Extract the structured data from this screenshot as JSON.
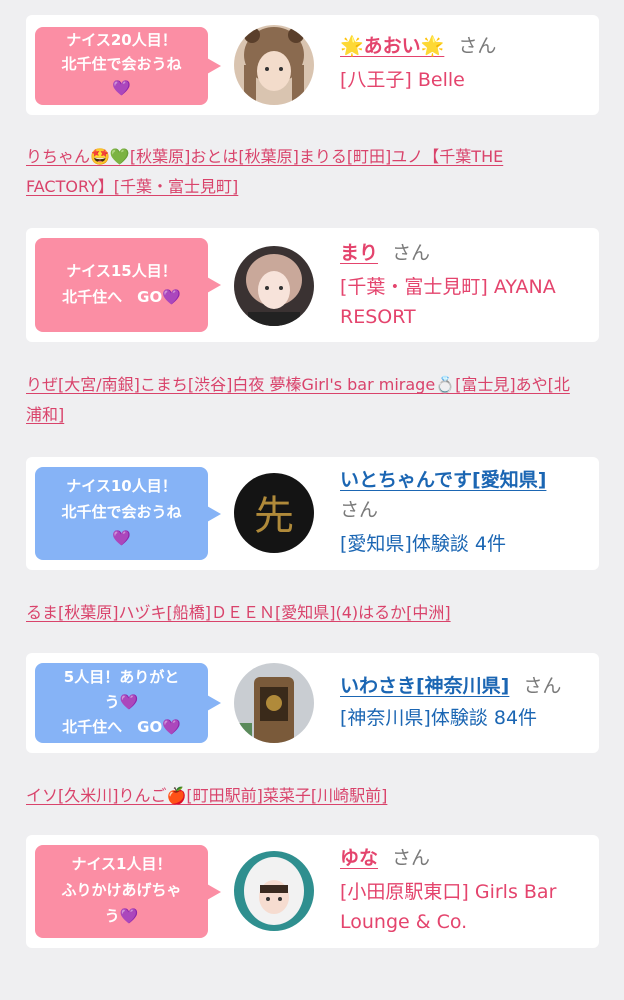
{
  "cards": [
    {
      "bubble_lines": [
        "ナイス20人目！",
        "北千住で会おうね",
        "💜"
      ],
      "name": "🌟あおい🌟",
      "san": "さん",
      "sub_lines": [
        "[八王子] Belle"
      ]
    },
    {
      "bubble_lines": [
        "ナイス15人目！",
        "北千住へ　GO💜"
      ],
      "name": "まり",
      "san": "さん",
      "sub_lines": [
        "[千葉・富士見町] AYANA",
        "RESORT"
      ]
    },
    {
      "bubble_lines": [
        "ナイス10人目！",
        "北千住で会おうね",
        "💜"
      ],
      "name": "いとちゃんです[愛知県]",
      "san": "さん",
      "sub_lines": [
        "[愛知県]体験談 4件"
      ],
      "avatar_text": "先"
    },
    {
      "bubble_lines": [
        "5人目！ありがと",
        "う💜",
        "北千住へ　GO💜"
      ],
      "name": "いわさき[神奈川県]",
      "san": "さん",
      "sub_lines": [
        "[神奈川県]体験談 84件"
      ]
    },
    {
      "bubble_lines": [
        "ナイス1人目！",
        "ふりかけあげちゃ",
        "う💜"
      ],
      "name": "ゆな",
      "san": "さん",
      "sub_lines": [
        "[小田原駅東口] Girls Bar",
        "Lounge & Co."
      ]
    }
  ],
  "link_rows": [
    {
      "lines": [
        "りちゃん🤩💚[秋葉原]おとは[秋葉原]まりる[町田]ユノ【千葉THE",
        "FACTORY】[千葉・富士見町]"
      ]
    },
    {
      "lines": [
        "りぜ[大宮/南銀]こまち[渋谷]白夜 夢榛Girl's bar mirage💍[富士見]あや[北",
        "浦和]"
      ]
    },
    {
      "lines": [
        "るま[秋葉原]ハヅキ[船橋]ＤＥＥＮ[愛知県](4)はるか[中洲]"
      ]
    },
    {
      "lines": [
        "イソ[久米川]りんご🍎[町田駅前]菜菜子[川崎駅前]"
      ]
    }
  ],
  "colors": {
    "accent_pink": "#e4446d",
    "accent_blue": "#1b66b3",
    "bubble_pink": "#fb8ea4",
    "bubble_blue": "#86b3f6"
  }
}
